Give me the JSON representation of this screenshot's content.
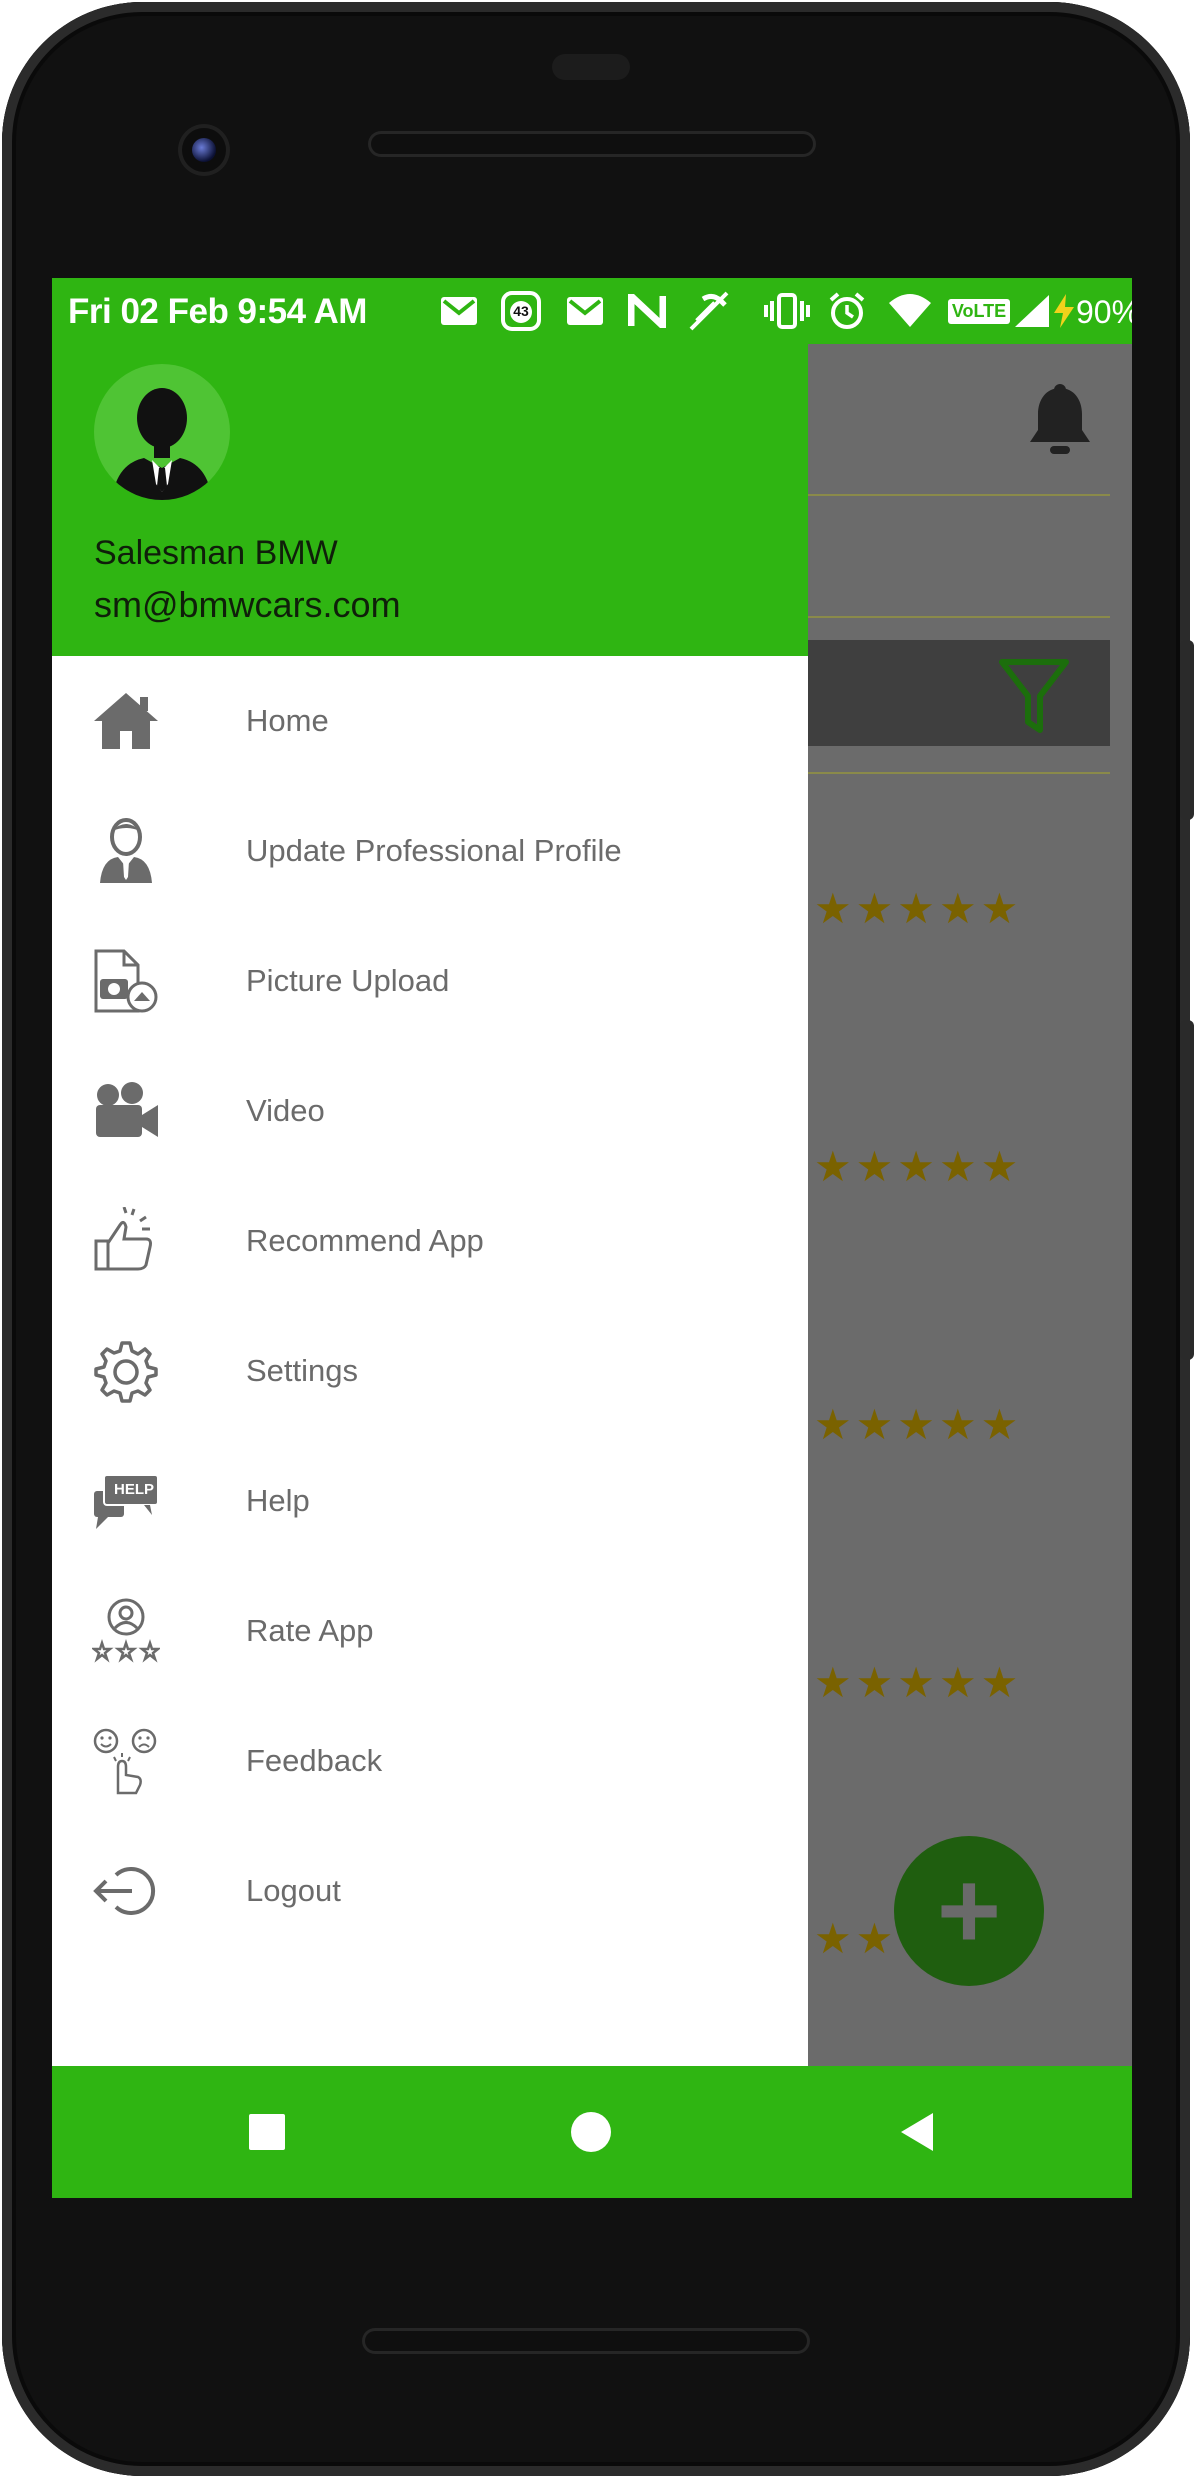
{
  "status_bar": {
    "time": "Fri 02 Feb 9:54 AM",
    "notification_badge": "43",
    "network_label": "VoLTE",
    "battery_percent": "90%",
    "icons": [
      "gmail-icon",
      "notification-count-icon",
      "gmail-icon",
      "n-app-icon",
      "mute-icon",
      "vibrate-icon",
      "alarm-icon",
      "wifi-icon",
      "volte-icon",
      "signal-icon",
      "charging-icon"
    ]
  },
  "drawer": {
    "user": {
      "name": "Salesman BMW",
      "email": "sm@bmwcars.com"
    },
    "items": [
      {
        "label": "Home",
        "icon": "home-icon"
      },
      {
        "label": "Update Professional Profile",
        "icon": "profile-icon"
      },
      {
        "label": "Picture Upload",
        "icon": "picture-upload-icon"
      },
      {
        "label": "Video",
        "icon": "video-camera-icon"
      },
      {
        "label": "Recommend App",
        "icon": "thumbs-up-icon"
      },
      {
        "label": "Settings",
        "icon": "gear-icon"
      },
      {
        "label": "Help",
        "icon": "help-chat-icon"
      },
      {
        "label": "Rate App",
        "icon": "rate-app-icon"
      },
      {
        "label": "Feedback",
        "icon": "feedback-icon"
      },
      {
        "label": "Logout",
        "icon": "logout-icon"
      }
    ],
    "help_badge": "HELP"
  },
  "background": {
    "star_rows": [
      "★★★★★",
      "★★★★★",
      "★★★★★",
      "★★★★★",
      "★★"
    ],
    "fab_symbol": "+"
  },
  "colors": {
    "brand_green": "#2fb512",
    "scrim_gray": "#6b6b6b",
    "menu_text": "#6b6b6b",
    "star_color": "#7a6200",
    "fab_green": "#1f5e0f"
  },
  "nav_bar": {
    "buttons": [
      "recents-button",
      "home-button",
      "back-button"
    ]
  }
}
